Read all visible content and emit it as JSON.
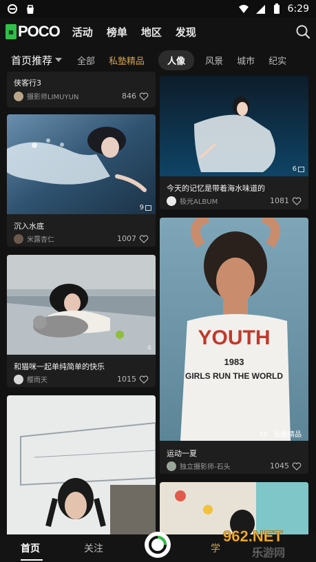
{
  "status_bar": {
    "time": "6:29"
  },
  "top_nav": {
    "logo_text": "POCO",
    "items": [
      "活动",
      "榜单",
      "地区",
      "发现"
    ]
  },
  "category_bar": {
    "main": "首页推荐",
    "items": [
      {
        "label": "全部"
      },
      {
        "label": "私塾精品",
        "color": "#d4a24a"
      },
      {
        "label": "人像"
      },
      {
        "label": "风景"
      },
      {
        "label": "城市"
      },
      {
        "label": "纪实"
      }
    ],
    "active": "人像"
  },
  "cards": [
    {
      "title": "侠客行3",
      "author": "摄影师LIMUYUN",
      "likes": "846"
    },
    {
      "title": "沉入水底",
      "author": "米露杏仁",
      "likes": "1007",
      "photo_count": "9"
    },
    {
      "title": "和猫咪一起单纯简单的快乐",
      "author": "樱雨天",
      "likes": "1015",
      "photo_count": "4"
    },
    {
      "title": "今天的记忆是带着海水味道的",
      "author": "极光ALBUM",
      "likes": "1081",
      "photo_count": "6"
    },
    {
      "title": "运动一夏",
      "author": "独立摄影师-石头",
      "likes": "1045",
      "photo_count": "10",
      "badge": "私塾精品"
    }
  ],
  "shirt_text": {
    "line1": "YOUTH",
    "line2": "1983",
    "line3": "GIRLS RUN THE WORLD"
  },
  "tab_bar": {
    "home": "首页",
    "follow": "关注",
    "learn": "学"
  },
  "watermark": {
    "line1": "962.NET",
    "line2": "乐游网"
  },
  "colors": {
    "background": "#121212",
    "card": "#1e1e1e",
    "accent_gold": "#d4a24a",
    "logo_green": "#2fbf4a"
  }
}
